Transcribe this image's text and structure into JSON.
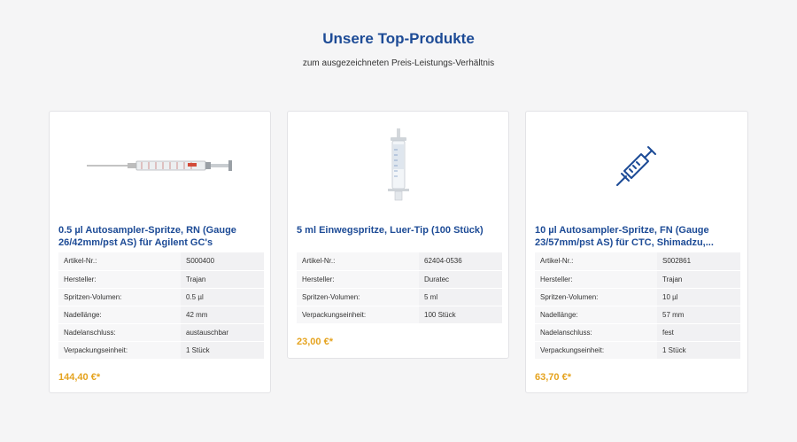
{
  "section": {
    "title": "Unsere Top-Produkte",
    "subtitle": "zum ausgezeichneten Preis-Leistungs-Verhältnis"
  },
  "colors": {
    "title": "#1d4b96",
    "price": "#e5a31f",
    "background": "#f5f5f6"
  },
  "products": [
    {
      "name": "0.5 µl Autosampler-Spritze, RN (Gauge 26/42mm/pst AS) für Agilent GC's",
      "image": "syringe-glass-horizontal-image",
      "specs": [
        {
          "label": "Artikel-Nr.:",
          "value": "S000400"
        },
        {
          "label": "Hersteller:",
          "value": "Trajan"
        },
        {
          "label": "Spritzen-Volumen:",
          "value": "0.5 µl"
        },
        {
          "label": "Nadellänge:",
          "value": "42 mm"
        },
        {
          "label": "Nadelanschluss:",
          "value": "austauschbar"
        },
        {
          "label": "Verpackungseinheit:",
          "value": "1 Stück"
        }
      ],
      "price": "144,40 €*"
    },
    {
      "name": "5 ml Einwegspritze, Luer-Tip (100 Stück)",
      "image": "disposable-syringe-image",
      "specs": [
        {
          "label": "Artikel-Nr.:",
          "value": "62404-0536"
        },
        {
          "label": "Hersteller:",
          "value": "Duratec"
        },
        {
          "label": "Spritzen-Volumen:",
          "value": "5 ml"
        },
        {
          "label": "Verpackungseinheit:",
          "value": "100 Stück"
        }
      ],
      "price": "23,00 €*"
    },
    {
      "name": "10 µl Autosampler-Spritze, FN (Gauge 23/57mm/pst AS) für CTC, Shimadzu,...",
      "image": "syringe-icon",
      "specs": [
        {
          "label": "Artikel-Nr.:",
          "value": "S002861"
        },
        {
          "label": "Hersteller:",
          "value": "Trajan"
        },
        {
          "label": "Spritzen-Volumen:",
          "value": "10 µl"
        },
        {
          "label": "Nadellänge:",
          "value": "57 mm"
        },
        {
          "label": "Nadelanschluss:",
          "value": "fest"
        },
        {
          "label": "Verpackungseinheit:",
          "value": "1 Stück"
        }
      ],
      "price": "63,70 €*"
    }
  ]
}
